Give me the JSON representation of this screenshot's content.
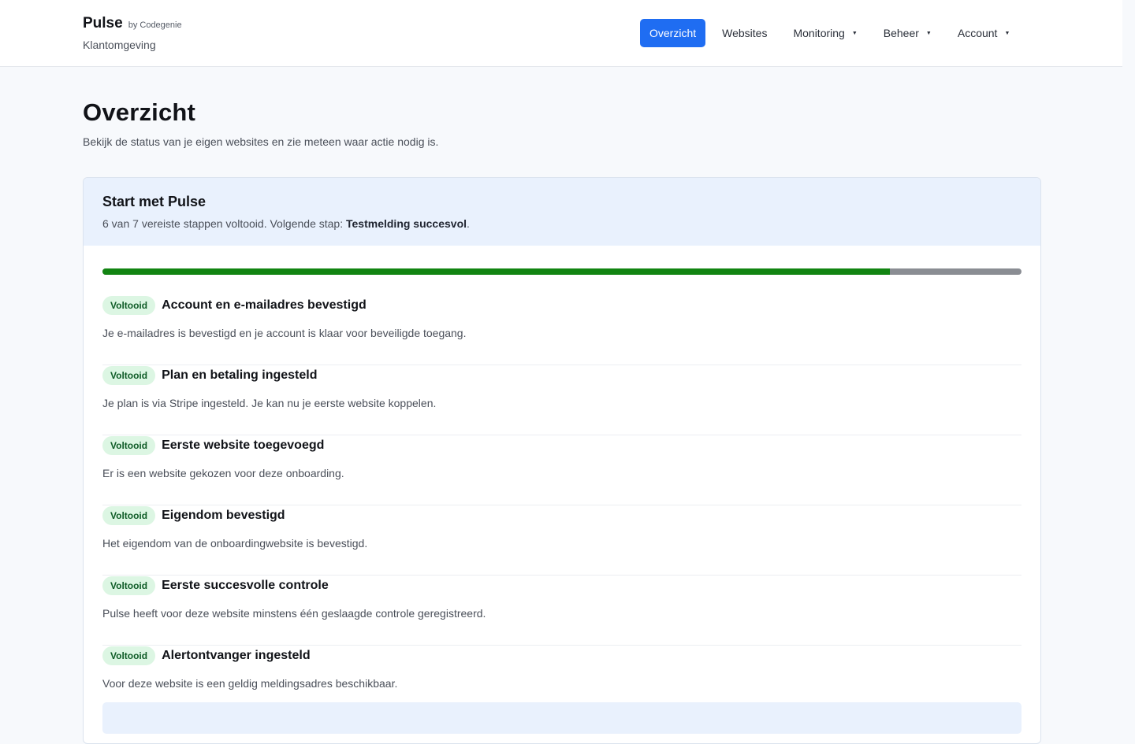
{
  "brand": {
    "name": "Pulse",
    "by": "by Codegenie",
    "subtitle": "Klantomgeving"
  },
  "nav": {
    "items": [
      {
        "label": "Overzicht",
        "active": true,
        "dropdown": false
      },
      {
        "label": "Websites",
        "active": false,
        "dropdown": false
      },
      {
        "label": "Monitoring",
        "active": false,
        "dropdown": true
      },
      {
        "label": "Beheer",
        "active": false,
        "dropdown": true
      },
      {
        "label": "Account",
        "active": false,
        "dropdown": true
      }
    ],
    "caret_icon": "caret-down-icon"
  },
  "page": {
    "title": "Overzicht",
    "subtitle": "Bekijk de status van je eigen websites en zie meteen waar actie nodig is."
  },
  "onboarding": {
    "title": "Start met Pulse",
    "summary_prefix": "6 van 7 vereiste stappen voltooid. Volgende stap: ",
    "next_step": "Testmelding succesvol",
    "summary_suffix": ".",
    "completed": 6,
    "total": 7,
    "progress_color": "#128412",
    "steps": [
      {
        "badge": "Voltooid",
        "title": "Account en e-mailadres bevestigd",
        "description": "Je e-mailadres is bevestigd en je account is klaar voor beveiligde toegang."
      },
      {
        "badge": "Voltooid",
        "title": "Plan en betaling ingesteld",
        "description": "Je plan is via Stripe ingesteld. Je kan nu je eerste website koppelen."
      },
      {
        "badge": "Voltooid",
        "title": "Eerste website toegevoegd",
        "description": "Er is een website gekozen voor deze onboarding."
      },
      {
        "badge": "Voltooid",
        "title": "Eigendom bevestigd",
        "description": "Het eigendom van de onboardingwebsite is bevestigd."
      },
      {
        "badge": "Voltooid",
        "title": "Eerste succesvolle controle",
        "description": "Pulse heeft voor deze website minstens één geslaagde controle geregistreerd."
      },
      {
        "badge": "Voltooid",
        "title": "Alertontvanger ingesteld",
        "description": "Voor deze website is een geldig meldingsadres beschikbaar."
      }
    ]
  },
  "colors": {
    "accent": "#1f6df2",
    "badge_bg": "#dcf6e3",
    "badge_text": "#0f5c27",
    "card_head_bg": "#e9f1fd"
  }
}
